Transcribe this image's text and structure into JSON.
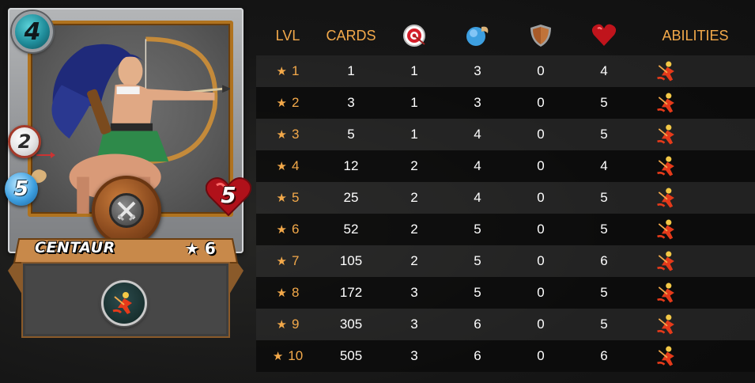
{
  "card": {
    "name": "CENTAUR",
    "level_label": "★ 6",
    "mana": "4",
    "attack": "2",
    "speed": "5",
    "health": "5",
    "ability_icon": "ranged-archer-icon"
  },
  "table": {
    "headers": {
      "lvl": "LVL",
      "cards": "CARDS",
      "attack_icon": "ranged-attack-target-icon",
      "speed_icon": "speed-icon",
      "armor_icon": "armor-shield-icon",
      "health_icon": "health-heart-icon",
      "abilities": "ABILITIES"
    },
    "rows": [
      {
        "lvl": "1",
        "cards": "1",
        "attack": "1",
        "speed": "3",
        "armor": "0",
        "health": "4"
      },
      {
        "lvl": "2",
        "cards": "3",
        "attack": "1",
        "speed": "3",
        "armor": "0",
        "health": "5"
      },
      {
        "lvl": "3",
        "cards": "5",
        "attack": "1",
        "speed": "4",
        "armor": "0",
        "health": "5"
      },
      {
        "lvl": "4",
        "cards": "12",
        "attack": "2",
        "speed": "4",
        "armor": "0",
        "health": "4"
      },
      {
        "lvl": "5",
        "cards": "25",
        "attack": "2",
        "speed": "4",
        "armor": "0",
        "health": "5"
      },
      {
        "lvl": "6",
        "cards": "52",
        "attack": "2",
        "speed": "5",
        "armor": "0",
        "health": "5"
      },
      {
        "lvl": "7",
        "cards": "105",
        "attack": "2",
        "speed": "5",
        "armor": "0",
        "health": "6"
      },
      {
        "lvl": "8",
        "cards": "172",
        "attack": "3",
        "speed": "5",
        "armor": "0",
        "health": "5"
      },
      {
        "lvl": "9",
        "cards": "305",
        "attack": "3",
        "speed": "6",
        "armor": "0",
        "health": "5"
      },
      {
        "lvl": "10",
        "cards": "505",
        "attack": "3",
        "speed": "6",
        "armor": "0",
        "health": "6"
      }
    ],
    "star_glyph": "★"
  },
  "colors": {
    "header_text": "#f3a94a",
    "row_text": "#ffffff",
    "frame_border": "#b0731f"
  }
}
